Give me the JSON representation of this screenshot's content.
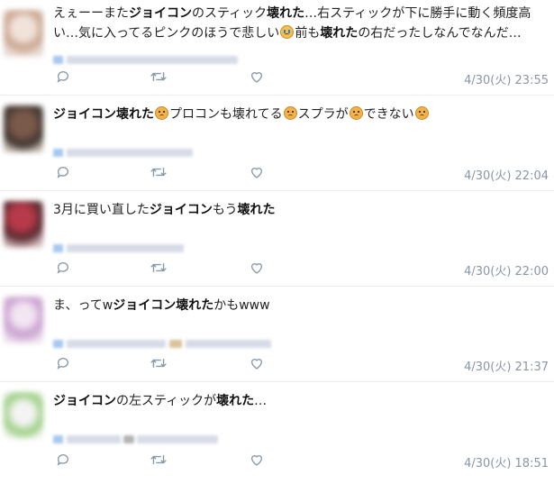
{
  "tweets": [
    {
      "segments": [
        {
          "t": "えぇーーまた",
          "b": false
        },
        {
          "t": "ジョイコン",
          "b": true
        },
        {
          "t": "のスティック",
          "b": false
        },
        {
          "t": "壊れた",
          "b": true
        },
        {
          "t": "…右スティックが下に勝手に動く頻度高い…気に入ってるピンクのほうで悲しい",
          "b": false
        },
        {
          "e": "cry"
        },
        {
          "t": "前も",
          "b": false
        },
        {
          "t": "壊れた",
          "b": true
        },
        {
          "t": "の右だったしなんでなんだ…",
          "b": false
        }
      ],
      "time": "4/30(火) 23:55",
      "avatar": "avatar-1"
    },
    {
      "segments": [
        {
          "t": "ジョイコン壊れた",
          "b": true
        },
        {
          "e": "sad"
        },
        {
          "t": "プロコンも壊れてる",
          "b": false
        },
        {
          "e": "sad"
        },
        {
          "t": "スプラが",
          "b": false
        },
        {
          "e": "sad"
        },
        {
          "t": "できない",
          "b": false
        },
        {
          "e": "sad"
        }
      ],
      "time": "4/30(火) 22:04",
      "avatar": "avatar-2"
    },
    {
      "segments": [
        {
          "t": "3月に買い直した",
          "b": false
        },
        {
          "t": "ジョイコン",
          "b": true
        },
        {
          "t": "もう",
          "b": false
        },
        {
          "t": "壊れた",
          "b": true
        }
      ],
      "time": "4/30(火) 22:00",
      "avatar": "avatar-3"
    },
    {
      "segments": [
        {
          "t": "ま、ってw",
          "b": false
        },
        {
          "t": "ジョイコン壊れた",
          "b": true
        },
        {
          "t": "かもwww",
          "b": false
        }
      ],
      "time": "4/30(火) 21:37",
      "avatar": "avatar-4"
    },
    {
      "segments": [
        {
          "t": "ジョイコン",
          "b": true
        },
        {
          "t": "の左スティックが",
          "b": false
        },
        {
          "t": "壊れた",
          "b": true
        },
        {
          "t": "…",
          "b": false
        }
      ],
      "time": "4/30(火) 18:51",
      "avatar": "avatar-5"
    }
  ],
  "actions": {
    "reply_icon": "reply-icon",
    "retweet_icon": "retweet-icon",
    "like_icon": "heart-icon"
  },
  "colors": {
    "timestamp": "#8a96a8",
    "icon": "#8899a6",
    "divider": "#e6ecf0"
  }
}
